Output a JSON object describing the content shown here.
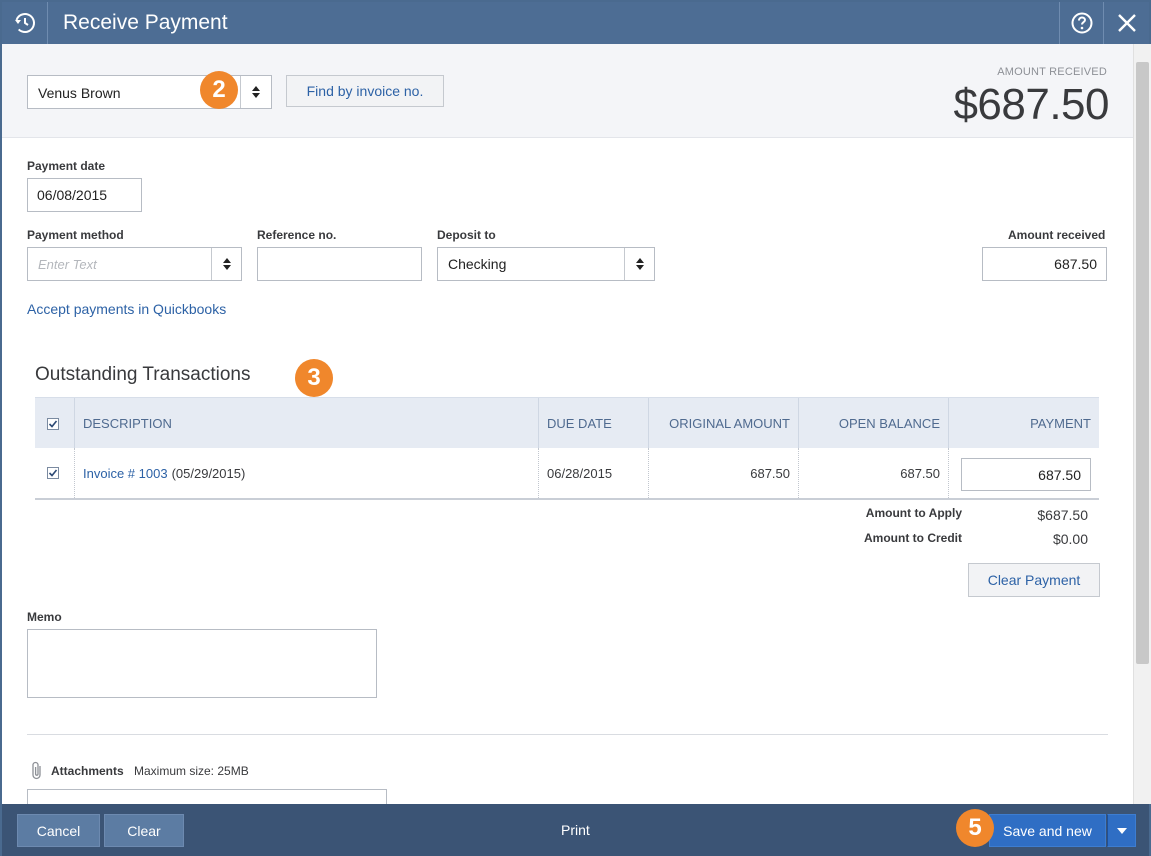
{
  "window": {
    "title": "Receive Payment"
  },
  "customer": {
    "value": "Venus Brown"
  },
  "find_button": "Find by invoice no.",
  "amount_received_header": {
    "label": "AMOUNT RECEIVED",
    "value": "$687.50"
  },
  "payment_date": {
    "label": "Payment date",
    "value": "06/08/2015"
  },
  "payment_method": {
    "label": "Payment method",
    "placeholder": "Enter Text"
  },
  "reference": {
    "label": "Reference no.",
    "value": ""
  },
  "deposit_to": {
    "label": "Deposit to",
    "value": "Checking"
  },
  "amount_received_field": {
    "label": "Amount received",
    "value": "687.50"
  },
  "accept_payments_link": "Accept payments in Quickbooks",
  "badges": [
    "2",
    "3",
    "5"
  ],
  "outstanding": {
    "title": "Outstanding Transactions",
    "columns": [
      "DESCRIPTION",
      "DUE DATE",
      "ORIGINAL AMOUNT",
      "OPEN BALANCE",
      "PAYMENT"
    ],
    "rows": [
      {
        "checked": true,
        "invoice_link": "Invoice # 1003",
        "invoice_date": "(05/29/2015)",
        "due_date": "06/28/2015",
        "original_amount": "687.50",
        "open_balance": "687.50",
        "payment": "687.50"
      }
    ],
    "amount_to_apply_label": "Amount to Apply",
    "amount_to_apply_value": "$687.50",
    "amount_to_credit_label": "Amount to Credit",
    "amount_to_credit_value": "$0.00",
    "clear_payment_label": "Clear Payment"
  },
  "memo": {
    "label": "Memo",
    "value": ""
  },
  "attachments": {
    "label": "Attachments",
    "note": "Maximum size: 25MB"
  },
  "footer": {
    "cancel": "Cancel",
    "clear": "Clear",
    "print": "Print",
    "save": "Save and new"
  },
  "colors": {
    "title_bar": "#4d6d94",
    "footer": "#3b5475",
    "accent_badge": "#f0872c",
    "primary_button": "#2f6ec4",
    "link": "#2d62a6"
  }
}
